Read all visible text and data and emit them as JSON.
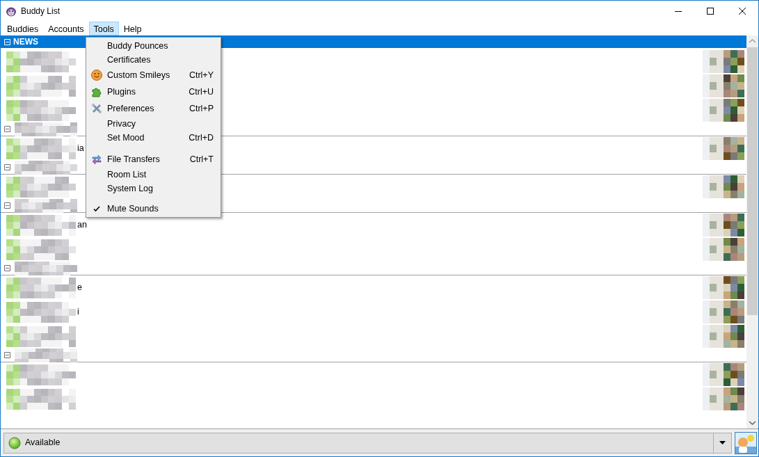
{
  "window": {
    "title": "Buddy List"
  },
  "menubar": [
    {
      "label": "Buddies",
      "selected": false
    },
    {
      "label": "Accounts",
      "selected": false
    },
    {
      "label": "Tools",
      "selected": true
    },
    {
      "label": "Help",
      "selected": false
    }
  ],
  "tools_menu": [
    {
      "kind": "plain",
      "label": "Buddy Pounces"
    },
    {
      "kind": "plain",
      "label": "Certificates"
    },
    {
      "kind": "smiley",
      "label": "Custom Smileys",
      "shortcut": "Ctrl+Y"
    },
    {
      "kind": "puzzle",
      "label": "Plugins",
      "shortcut": "Ctrl+U"
    },
    {
      "kind": "tools",
      "label": "Preferences",
      "shortcut": "Ctrl+P"
    },
    {
      "kind": "plain",
      "label": "Privacy"
    },
    {
      "kind": "plain",
      "label": "Set Mood",
      "shortcut": "Ctrl+D"
    },
    {
      "kind": "separator"
    },
    {
      "kind": "transfer",
      "label": "File Transfers",
      "shortcut": "Ctrl+T"
    },
    {
      "kind": "plain",
      "label": "Room List"
    },
    {
      "kind": "plain",
      "label": "System Log"
    },
    {
      "kind": "separator"
    },
    {
      "kind": "check",
      "label": "Mute Sounds",
      "checked": true
    }
  ],
  "groups": [
    {
      "name": "NEWS",
      "selected": true,
      "expanded": true,
      "buddies": [
        {
          "online": true
        },
        {
          "online": true
        },
        {
          "online": true
        }
      ]
    },
    {
      "selected": false,
      "expanded": true,
      "buddies": [
        {
          "online": true,
          "name_tail": "ia"
        }
      ]
    },
    {
      "selected": false,
      "expanded": true,
      "buddies": [
        {
          "online": true
        }
      ]
    },
    {
      "selected": false,
      "expanded": true,
      "buddies": [
        {
          "online": true,
          "name_tail": "an"
        },
        {
          "online": true
        }
      ]
    },
    {
      "selected": false,
      "expanded": true,
      "buddies": [
        {
          "online": true,
          "name_tail": "e"
        },
        {
          "online": true,
          "name_tail": "i"
        },
        {
          "online": true
        }
      ]
    },
    {
      "selected": false,
      "expanded": true,
      "buddies": [
        {
          "online": true
        },
        {
          "online": true
        }
      ]
    }
  ],
  "status_bar": {
    "status": "Available"
  }
}
